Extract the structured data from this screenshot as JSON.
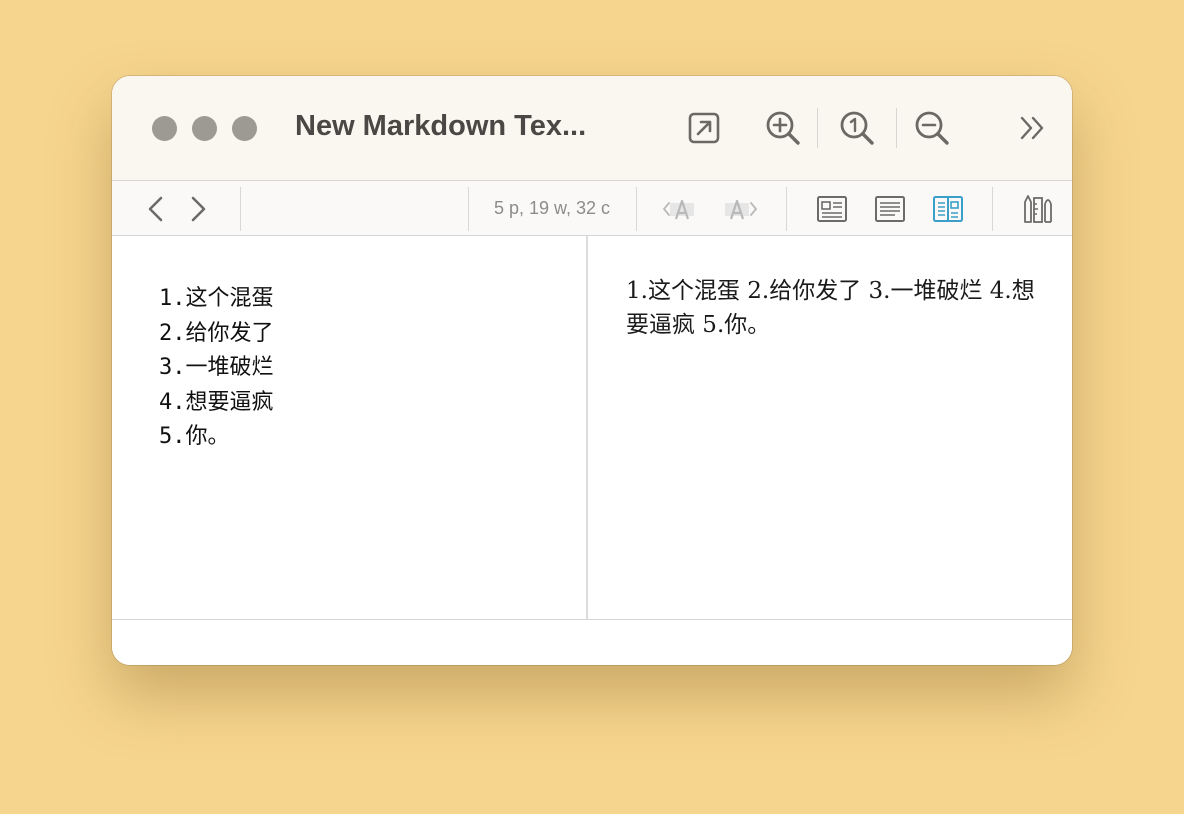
{
  "window": {
    "title": "New Markdown Tex...",
    "traffic_light_color": "#9d9993"
  },
  "titlebar_icons": [
    "open-external-icon",
    "zoom-in-icon",
    "actual-size-icon",
    "zoom-out-icon",
    "more-chevrons-icon"
  ],
  "toolbar": {
    "back_icon": "chevron-left-icon",
    "forward_icon": "chevron-right-icon",
    "stats": "5 p, 19 w, 32 c",
    "font_decrease_icon": "font-smaller-icon",
    "font_increase_icon": "font-larger-icon",
    "view_modes": [
      "preview-only-icon",
      "editor-only-icon",
      "split-view-icon"
    ],
    "active_view": "split-view-icon",
    "active_color": "#3aa0c9",
    "tools_icon": "tools-icon"
  },
  "editor": {
    "lines": [
      "1.这个混蛋",
      "2.给你发了",
      "3.一堆破烂",
      "4.想要逼疯",
      "5.你。"
    ]
  },
  "preview": {
    "text": "1.这个混蛋 2.给你发了 3.一堆破烂 4.想要逼疯 5.你。"
  }
}
